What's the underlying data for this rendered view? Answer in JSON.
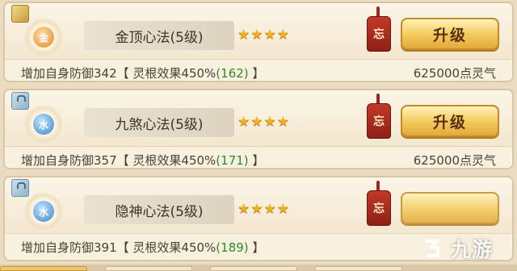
{
  "skills": [
    {
      "element": "金",
      "element_style": "gold",
      "corner": "plain",
      "name": "金顶心法(5级)",
      "stars": 4,
      "forget_label": "忘",
      "upgrade_label": "升级",
      "upgrade_visible": "full",
      "desc_prefix": "增加自身防御342【 灵根效果450%",
      "desc_value": "(162)",
      "desc_suffix": " 】",
      "cost": "625000点灵气"
    },
    {
      "element": "水",
      "element_style": "water",
      "corner": "lock",
      "name": "九煞心法(5级)",
      "stars": 4,
      "forget_label": "忘",
      "upgrade_label": "升级",
      "upgrade_visible": "full",
      "desc_prefix": "增加自身防御357【 灵根效果450%",
      "desc_value": "(171)",
      "desc_suffix": " 】",
      "cost": "625000点灵气"
    },
    {
      "element": "水",
      "element_style": "water",
      "corner": "lock",
      "name": "隐神心法(5级)",
      "stars": 4,
      "forget_label": "忘",
      "upgrade_label": "",
      "upgrade_visible": "partial",
      "desc_prefix": "增加自身防御391【 灵根效果450%",
      "desc_value": "(189)",
      "desc_suffix": " 】",
      "cost": ""
    }
  ],
  "watermark": {
    "text": "九游",
    "icon": "jiuyou-logo-icon"
  },
  "colors": {
    "highlight_green": "#2f8a2a",
    "star": "#f0b020",
    "forget_tag": "#c23a2a",
    "upgrade_button": "#f3c85a"
  }
}
